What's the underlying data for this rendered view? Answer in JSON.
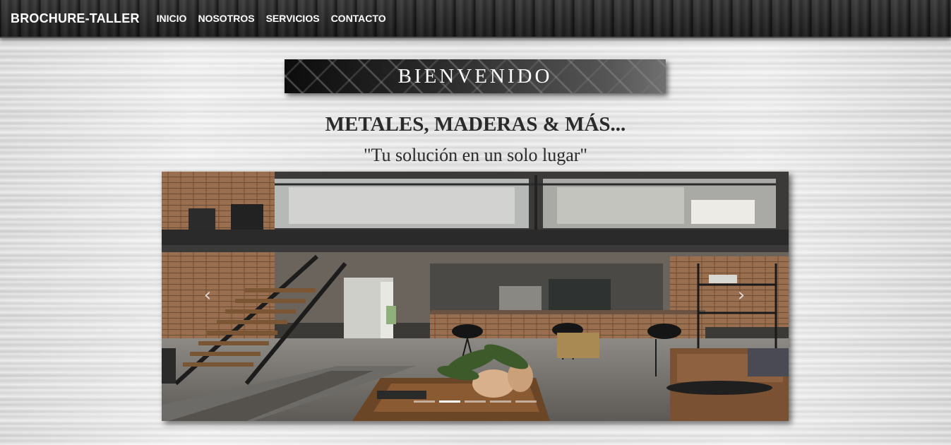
{
  "navbar": {
    "brand": "BROCHURE-TALLER",
    "links": [
      {
        "label": "INICIO"
      },
      {
        "label": "NOSOTROS"
      },
      {
        "label": "SERVICIOS"
      },
      {
        "label": "CONTACTO"
      }
    ]
  },
  "banner": {
    "title": "BIENVENIDO"
  },
  "main": {
    "heading": "METALES, MADERAS & MÁS...",
    "tagline": "\"Tu solución en un solo lugar\""
  },
  "carousel": {
    "prev_icon": "chevron-left-icon",
    "next_icon": "chevron-right-icon",
    "prev_glyph": "‹",
    "next_glyph": "›",
    "slide_count": 5,
    "active_index": 1,
    "slide_image": "industrial-loft-interior"
  },
  "colors": {
    "navbar": "#2b2b2b",
    "text": "#2a2a2a",
    "banner_text": "#ffffff"
  }
}
